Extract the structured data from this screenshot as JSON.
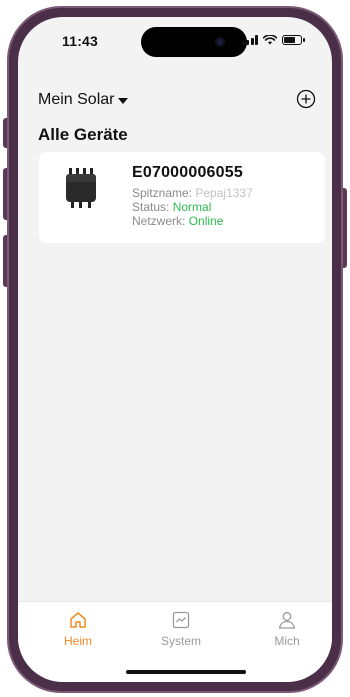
{
  "status_bar": {
    "time": "11:43"
  },
  "header": {
    "title": "Mein Solar",
    "add_icon": "plus-circle-icon"
  },
  "section": {
    "title": "Alle Geräte"
  },
  "device": {
    "id": "E07000006055",
    "nickname_label": "Spitzname: ",
    "nickname_value": "Pepaj1337",
    "status_label": "Status: ",
    "status_value": "Normal",
    "network_label": "Netzwerk: ",
    "network_value": "Online"
  },
  "tabs": [
    {
      "label": "Heim",
      "icon": "home-icon",
      "active": true
    },
    {
      "label": "System",
      "icon": "chart-icon",
      "active": false
    },
    {
      "label": "Mich",
      "icon": "user-icon",
      "active": false
    }
  ],
  "colors": {
    "accent": "#f08a24",
    "online": "#2ebc4f",
    "frame": "#4b2f48"
  }
}
